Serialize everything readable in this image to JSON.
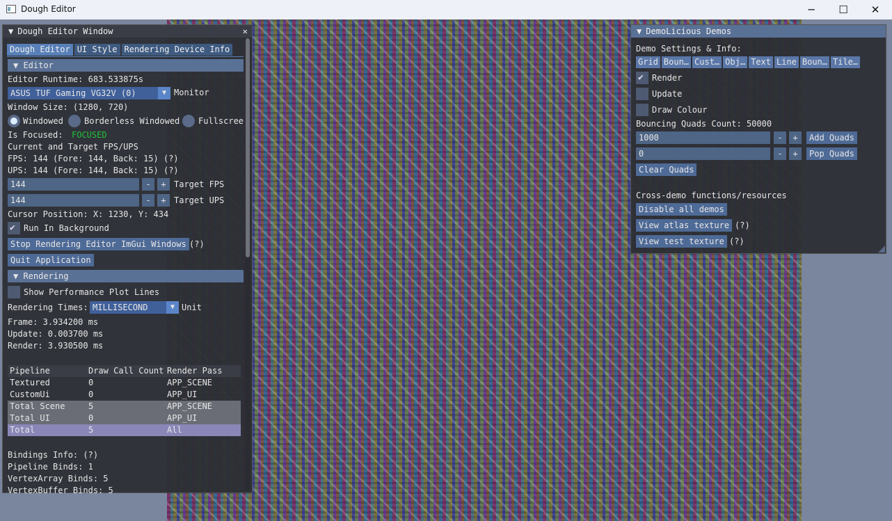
{
  "window": {
    "title": "Dough Editor",
    "minimize": "─",
    "maximize": "☐",
    "close": "✕"
  },
  "editor_panel": {
    "title": "Dough Editor Window",
    "close": "✕",
    "tabs": [
      "Dough Editor",
      "UI Style",
      "Rendering Device Info"
    ],
    "editor_header": "Editor",
    "runtime": "Editor Runtime: 683.533875s",
    "monitor_value": "ASUS TUF Gaming VG32V (0)",
    "monitor_label": "Monitor",
    "window_size": "Window Size: (1280, 720)",
    "modes": [
      "Windowed",
      "Borderless Windowed",
      "Fullscree"
    ],
    "is_focused_label": "Is Focused:",
    "is_focused_value": "FOCUSED",
    "fps_title": "Current and Target FPS/UPS",
    "fps_line": "FPS: 144     (Fore: 144, Back: 15) (?)",
    "ups_line": "UPS: 144     (Fore: 144, Back: 15) (?)",
    "target_fps_value": "144",
    "target_fps_label": "Target FPS",
    "target_ups_value": "144",
    "target_ups_label": "Target UPS",
    "minus": "-",
    "plus": "+",
    "cursor": "Cursor Position: X: 1230, Y: 434",
    "run_bg": "Run In Background",
    "stop_btn": "Stop Rendering Editor ImGui Windows",
    "help": "(?)",
    "quit_btn": "Quit Application",
    "rendering_header": "Rendering",
    "show_plot": "Show Performance Plot Lines",
    "rendering_times_label": "Rendering Times:",
    "rendering_times_value": "MILLISECOND",
    "unit_label": "Unit",
    "frame": "Frame:  3.934200 ms",
    "update": "Update:  0.003700 ms",
    "render": "Render:  3.930500 ms",
    "table_headers": [
      "Pipeline",
      "Draw Call Count",
      "Render Pass"
    ],
    "table_rows": [
      [
        "Textured",
        "0",
        "APP_SCENE"
      ],
      [
        "CustomUi",
        "0",
        "APP_UI"
      ],
      [
        "Total Scene",
        "5",
        "APP_SCENE"
      ],
      [
        "Total UI",
        "0",
        "APP_UI"
      ],
      [
        "Total",
        "5",
        "All"
      ]
    ],
    "bindings_info": "Bindings Info: (?)",
    "pipeline_binds": "Pipeline Binds: 1",
    "vertexarray_binds": "VertexArray Binds: 5",
    "vertexbuffer_binds": "VertexBuffer Binds: 5"
  },
  "demo_panel": {
    "title": "DemoLicious Demos",
    "settings_label": "Demo Settings & Info:",
    "tabs": [
      "Grid",
      "Boun…",
      "Cust…",
      "Obj…",
      "Text",
      "Line",
      "Boun…",
      "Tile…"
    ],
    "render": "Render",
    "update": "Update",
    "draw_colour": "Draw Colour",
    "quads_count": "Bouncing Quads Count: 50000",
    "add_value": "1000",
    "add_btn": "Add Quads",
    "pop_value": "0",
    "pop_btn": "Pop Quads",
    "clear_btn": "Clear Quads",
    "cross_demo": "Cross-demo functions/resources",
    "disable_btn": "Disable all demos",
    "atlas_btn": "View atlas texture",
    "test_btn": "View test texture",
    "help": "(?)",
    "minus": "-",
    "plus": "+"
  }
}
